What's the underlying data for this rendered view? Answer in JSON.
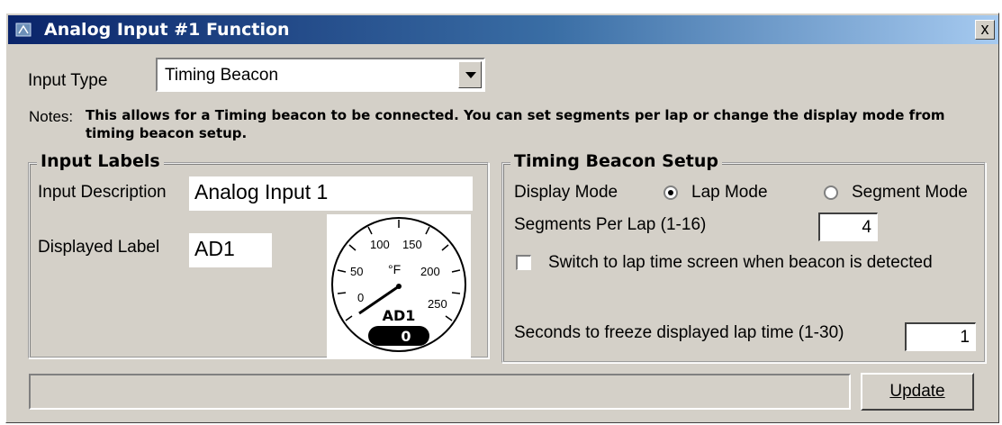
{
  "window": {
    "title": "Analog Input #1 Function",
    "close_label": "x",
    "app_icon": "gauge-window-icon"
  },
  "input_type": {
    "label": "Input Type",
    "value": "Timing Beacon"
  },
  "notes": {
    "label": "Notes:",
    "text": "This allows for a Timing beacon to be connected. You can set segments per lap or change the display mode from timing beacon setup."
  },
  "input_labels": {
    "title": "Input Labels",
    "description_label": "Input Description",
    "description_value": "Analog Input 1",
    "displayed_label": "Displayed Label",
    "displayed_value": "AD1"
  },
  "gauge": {
    "ticks": [
      "0",
      "50",
      "100",
      "150",
      "200",
      "250"
    ],
    "unit": "°F",
    "name": "AD1",
    "reading": "0"
  },
  "timing_beacon": {
    "title": "Timing Beacon Setup",
    "display_mode_label": "Display Mode",
    "lap_mode_label": "Lap Mode",
    "segment_mode_label": "Segment Mode",
    "lap_mode_selected": true,
    "segments_label": "Segments Per Lap (1-16)",
    "segments_value": "4",
    "switch_label": "Switch to lap time screen when beacon is detected",
    "switch_checked": false,
    "freeze_label": "Seconds to freeze displayed lap time (1-30)",
    "freeze_value": "1"
  },
  "footer": {
    "status_text": "",
    "update_label": "Update"
  },
  "colors": {
    "title_bar_start": "#0a246a",
    "title_bar_end": "#a6caf0",
    "dialog_face": "#d4d0c8"
  }
}
